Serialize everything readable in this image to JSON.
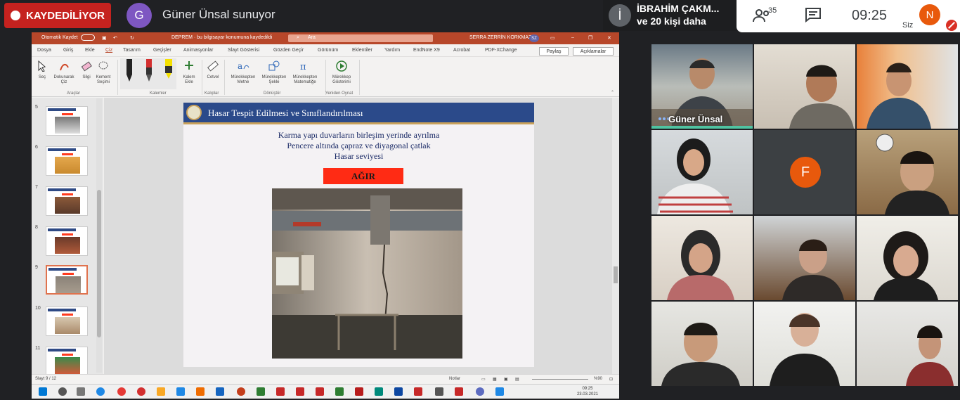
{
  "meet": {
    "recording_label": "KAYDEDİLİYOR",
    "presenter_initial": "G",
    "presenting_text": "Güner Ünsal sunuyor",
    "speaker_initial": "İ",
    "speaker_name": "İBRAHİM ÇAKM...",
    "speaker_others": "ve 20 kişi daha",
    "participant_count": "35",
    "clock": "09:25",
    "self_initial": "N",
    "self_label": "Siz"
  },
  "ppt": {
    "autosave_label": "Otomatik Kaydet",
    "file_title": "DEPREM  ·  bu bilgisayar konumuna kaydedildi",
    "search_placeholder": "Ara",
    "user_name": "SERRA ZERRİN KORKMAZ",
    "user_badge": "SZ",
    "menu": [
      "Dosya",
      "Giriş",
      "Ekle",
      "Çiz",
      "Tasarım",
      "Geçişler",
      "Animasyonlar",
      "Slayt Gösterisi",
      "Gözden Geçir",
      "Görünüm",
      "Eklentiler",
      "Yardım",
      "EndNote X9",
      "Acrobat",
      "PDF-XChange"
    ],
    "share_label": "Paylaş",
    "comments_label": "Açıklamalar",
    "ribbon": {
      "select": "Seç",
      "touch_draw": "Dokunarak Çiz",
      "eraser": "Silgi",
      "lasso": "Kement Seçimi",
      "tools_group": "Araçlar",
      "pens_group": "Kalemler",
      "add_pen": "Kalem Ekle",
      "ruler": "Cetvel",
      "stencils_group": "Kalıplar",
      "ink_to_text": "Mürekkepten Metne",
      "ink_to_shape": "Mürekkepten Şekle",
      "ink_to_math": "Mürekkepten Matematiğe",
      "convert_group": "Dönüştür",
      "ink_replay": "Mürekkep Gösterimi",
      "replay_group": "Yeniden Oynat"
    },
    "slide_numbers": [
      "5",
      "6",
      "7",
      "8",
      "9",
      "10",
      "11"
    ],
    "status_slide": "Slayt 9 / 12",
    "status_notes": "Notlar",
    "status_zoom": "%90",
    "slide": {
      "title": "Hasar Tespit Edilmesi ve Sınıflandırılması",
      "line1": "Karma yapı  duvarların birleşim yerinde ayrılma",
      "line2": "Pencere altında çapraz ve diyagonal çatlak",
      "line3": "Hasar seviyesi",
      "severity": "AĞIR"
    }
  },
  "taskbar": {
    "time": "09:25",
    "date": "23.03.2021"
  },
  "tiles": {
    "presenter_name": "Güner Ünsal",
    "f_initial": "F"
  }
}
